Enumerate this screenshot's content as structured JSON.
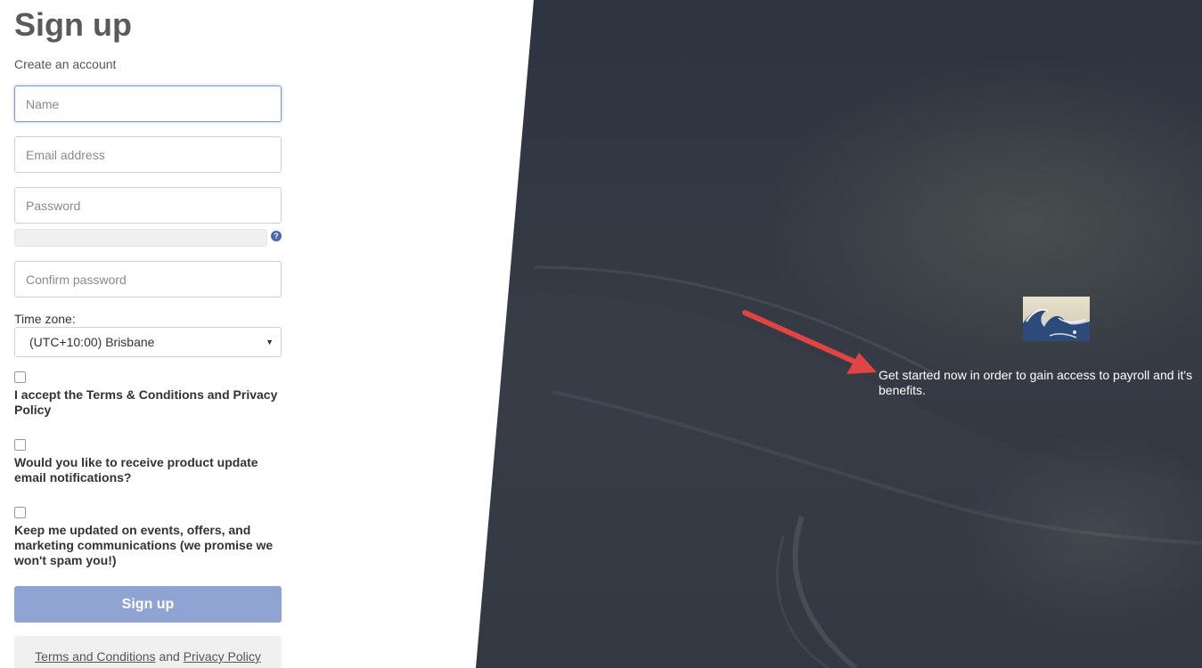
{
  "signup": {
    "title": "Sign up",
    "subtitle": "Create an account",
    "name_placeholder": "Name",
    "email_placeholder": "Email address",
    "password_placeholder": "Password",
    "confirm_placeholder": "Confirm password",
    "timezone_label": "Time zone:",
    "timezone_value": "(UTC+10:00) Brisbane",
    "terms_check_label": "I accept the Terms & Conditions and Privacy Policy",
    "updates_check_label": "Would you like to receive product update email notifications?",
    "marketing_check_label": "Keep me updated on events, offers, and marketing communications (we promise we won't spam you!)",
    "submit_label": "Sign up",
    "footer": {
      "terms_link": "Terms and Conditions",
      "and_text": "and",
      "privacy_link": "Privacy Policy"
    }
  },
  "hero": {
    "tagline": "Get started now in order to gain access to payroll and it's benefits.",
    "logo_icon": "great-wave-image",
    "arrow_color": "#e04444"
  },
  "colors": {
    "accent": "#8fa4d3",
    "help_icon": "#4a67b0"
  }
}
